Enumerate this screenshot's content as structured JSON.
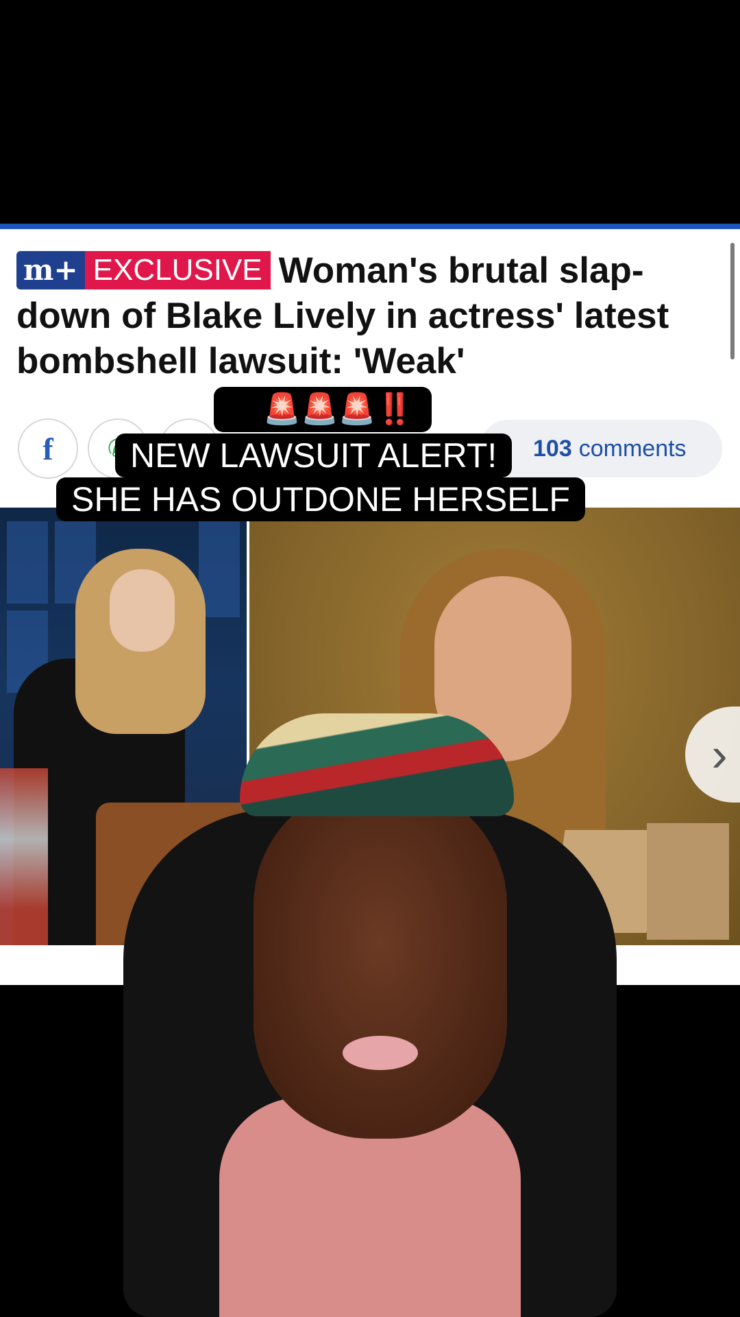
{
  "article": {
    "badge_brand": "m+",
    "badge_label": "EXCLUSIVE",
    "headline": "Woman's brutal slap-down of Blake Lively in actress' latest bombshell lawsuit: 'Weak'",
    "share": {
      "facebook_glyph": "f",
      "whatsapp_glyph": "✆"
    },
    "comments": {
      "count": "103",
      "label": "comments"
    },
    "next_glyph": "›"
  },
  "overlay": {
    "emojis": "😏🚨🚨🚨‼️",
    "caption_line1": "NEW LAWSUIT ALERT!",
    "caption_line2": "SHE HAS OUTDONE HERSELF"
  },
  "colors": {
    "brand_blue": "#1f3f8f",
    "exclusive_red": "#e0174b",
    "link_blue": "#1d4fa6",
    "headband_green": "#2b6a55",
    "headband_red": "#b9272b"
  }
}
